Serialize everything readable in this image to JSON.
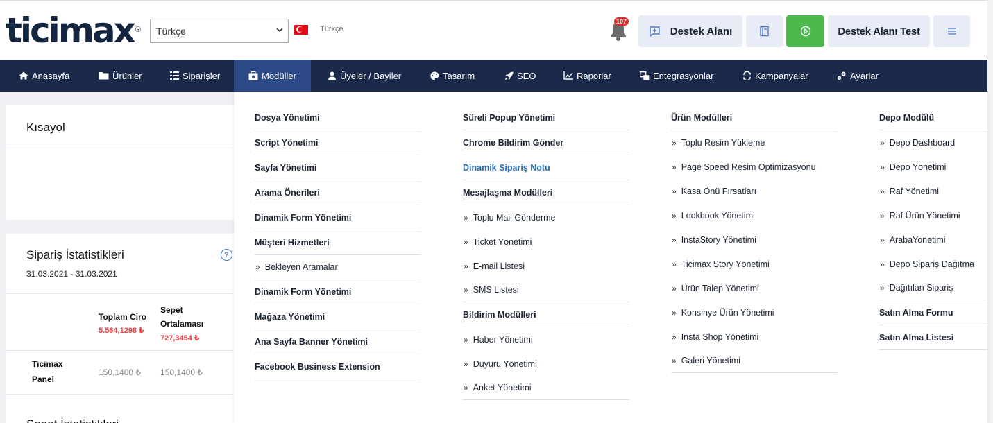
{
  "logo": {
    "text": "ticimax",
    "reg": "®"
  },
  "header": {
    "language_select": "Türkçe",
    "flag_label": "Türkçe",
    "notification_count": "107",
    "destek_label": "Destek Alanı",
    "store_label": "Destek Alanı Test",
    "play_color": "#4cb94f"
  },
  "nav": {
    "items": [
      "Anasayfa",
      "Ürünler",
      "Siparişler",
      "Modüller",
      "Üyeler / Bayiler",
      "Tasarım",
      "SEO",
      "Raporlar",
      "Entegrasyonlar",
      "Kampanyalar",
      "Ayarlar"
    ],
    "active": "Modüller"
  },
  "left": {
    "shortcut_title": "Kısayol",
    "stats_title": "Sipariş İstatistikleri",
    "stats_date": "31.03.2021 - 31.03.2021",
    "columns": [
      {
        "header": "Toplam Ciro",
        "value": "5.564,1298 ₺"
      },
      {
        "header": "Sepet Ortalaması",
        "value": "727,3454 ₺"
      }
    ],
    "row_label": "Ticimax Panel",
    "row_values": [
      "150,1400 ₺",
      "150,1400 ₺"
    ],
    "next_title": "Sepet İstatistikleri"
  },
  "dropdown": {
    "col1": [
      {
        "label": "Dosya Yönetimi"
      },
      {
        "label": "Script Yönetimi"
      },
      {
        "label": "Sayfa Yönetimi"
      },
      {
        "label": "Arama Önerileri"
      },
      {
        "label": "Dinamik Form Yönetimi"
      },
      {
        "label": "Müşteri Hizmetleri"
      },
      {
        "label": "Bekleyen Aramalar",
        "sub": true,
        "last": true
      },
      {
        "label": "Dinamik Form Yönetimi"
      },
      {
        "label": "Mağaza Yönetimi"
      },
      {
        "label": "Ana Sayfa Banner Yönetimi"
      },
      {
        "label": "Facebook Business Extension"
      }
    ],
    "col2": [
      {
        "label": "Süreli Popup Yönetimi"
      },
      {
        "label": "Chrome Bildirim Gönder"
      },
      {
        "label": "Dinamik Sipariş Notu",
        "hl": true
      },
      {
        "label": "Mesajlaşma Modülleri"
      },
      {
        "label": "Toplu Mail Gönderme",
        "sub": true
      },
      {
        "label": "Ticket Yönetimi",
        "sub": true
      },
      {
        "label": "E-mail Listesi",
        "sub": true
      },
      {
        "label": "SMS Listesi",
        "sub": true,
        "last": true
      },
      {
        "label": "Bildirim Modülleri"
      },
      {
        "label": "Haber Yönetimi",
        "sub": true
      },
      {
        "label": "Duyuru Yönetimi",
        "sub": true
      },
      {
        "label": "Anket Yönetimi",
        "sub": true,
        "last": true
      }
    ],
    "col3": [
      {
        "label": "Ürün Modülleri"
      },
      {
        "label": "Toplu Resim Yükleme",
        "sub": true
      },
      {
        "label": "Page Speed Resim Optimizasyonu",
        "sub": true
      },
      {
        "label": "Kasa Önü Fırsatları",
        "sub": true
      },
      {
        "label": "Lookbook Yönetimi",
        "sub": true
      },
      {
        "label": "InstaStory Yönetimi",
        "sub": true
      },
      {
        "label": "Ticimax Story Yönetimi",
        "sub": true
      },
      {
        "label": "Ürün Talep Yönetimi",
        "sub": true
      },
      {
        "label": "Konsinye Ürün Yönetimi",
        "sub": true
      },
      {
        "label": "Insta Shop Yönetimi",
        "sub": true
      },
      {
        "label": "Galeri Yönetimi",
        "sub": true,
        "last": true
      }
    ],
    "col4": [
      {
        "label": "Depo Modülü"
      },
      {
        "label": "Depo Dashboard",
        "sub": true
      },
      {
        "label": "Depo Yönetimi",
        "sub": true
      },
      {
        "label": "Raf Yönetimi",
        "sub": true
      },
      {
        "label": "Raf Ürün Yönetimi",
        "sub": true
      },
      {
        "label": "ArabaYonetimi",
        "sub": true
      },
      {
        "label": "Depo Sipariş Dağıtma",
        "sub": true
      },
      {
        "label": "Dağıtılan Sipariş",
        "sub": true,
        "last": true
      },
      {
        "label": "Satın Alma Formu"
      },
      {
        "label": "Satın Alma Listesi"
      }
    ]
  }
}
